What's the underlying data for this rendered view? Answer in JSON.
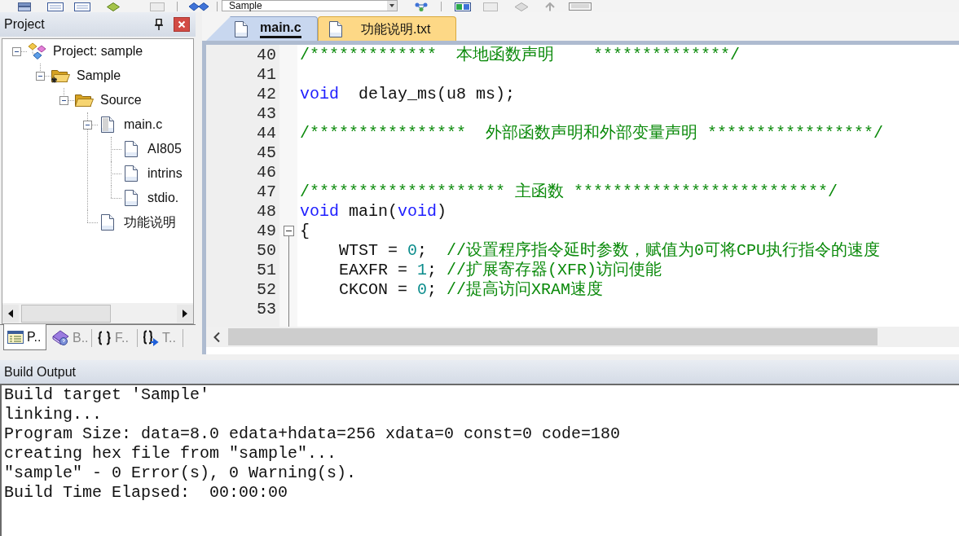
{
  "toolbar": {
    "target": "Sample"
  },
  "project_panel": {
    "title": "Project",
    "tree": [
      {
        "label": "Project: sample",
        "kind": "project",
        "expanded": true,
        "children": [
          {
            "label": "Sample",
            "kind": "target",
            "expanded": true,
            "children": [
              {
                "label": "Source",
                "kind": "folder",
                "expanded": true,
                "children": [
                  {
                    "label": "main.c",
                    "kind": "source",
                    "expanded": true,
                    "children": [
                      {
                        "label": "AI805",
                        "kind": "header"
                      },
                      {
                        "label": "intrins",
                        "kind": "header"
                      },
                      {
                        "label": "stdio.",
                        "kind": "header"
                      }
                    ]
                  },
                  {
                    "label": "功能说明",
                    "kind": "text"
                  }
                ]
              }
            ]
          }
        ]
      }
    ],
    "tabs": [
      {
        "label": "P..",
        "kind": "project",
        "selected": true
      },
      {
        "label": "B..",
        "kind": "books",
        "selected": false
      },
      {
        "label": "F..",
        "kind": "functions",
        "selected": false
      },
      {
        "label": "T..",
        "kind": "templates",
        "selected": false
      }
    ]
  },
  "editor": {
    "tabs": [
      {
        "label": "main.c",
        "selected": true
      },
      {
        "label": "功能说明.txt",
        "selected": false
      }
    ],
    "lines": [
      {
        "number": "40",
        "tokens": [
          {
            "kind": "comment",
            "text": "/*************  本地函数声明    **************/"
          }
        ]
      },
      {
        "number": "41"
      },
      {
        "number": "42",
        "tokens": [
          {
            "kind": "keyword",
            "text": "void"
          },
          {
            "kind": "plain",
            "text": "  delay_ms(u8 ms);"
          }
        ]
      },
      {
        "number": "43"
      },
      {
        "number": "44",
        "tokens": [
          {
            "kind": "comment",
            "text": "/****************  外部函数声明和外部变量声明 *****************/"
          }
        ]
      },
      {
        "number": "45"
      },
      {
        "number": "46"
      },
      {
        "number": "47",
        "tokens": [
          {
            "kind": "comment",
            "text": "/******************** 主函数 **************************/"
          }
        ]
      },
      {
        "number": "48",
        "tokens": [
          {
            "kind": "keyword",
            "text": "void"
          },
          {
            "kind": "plain",
            "text": " main("
          },
          {
            "kind": "keyword",
            "text": "void"
          },
          {
            "kind": "plain",
            "text": ")"
          }
        ]
      },
      {
        "number": "49",
        "fold": {
          "expanded": true
        },
        "tokens": [
          {
            "kind": "plain",
            "text": "{"
          }
        ]
      },
      {
        "number": "50",
        "tokens": [
          {
            "kind": "plain",
            "text": "    WTST = "
          },
          {
            "kind": "number",
            "text": "0"
          },
          {
            "kind": "plain",
            "text": ";  "
          },
          {
            "kind": "comment",
            "text": "//设置程序指令延时参数，赋值为0可将CPU执行指令的速度"
          }
        ]
      },
      {
        "number": "51",
        "tokens": [
          {
            "kind": "plain",
            "text": "    EAXFR = "
          },
          {
            "kind": "number",
            "text": "1"
          },
          {
            "kind": "plain",
            "text": "; "
          },
          {
            "kind": "comment",
            "text": "//扩展寄存器(XFR)访问使能"
          }
        ]
      },
      {
        "number": "52",
        "tokens": [
          {
            "kind": "plain",
            "text": "    CKCON = "
          },
          {
            "kind": "number",
            "text": "0"
          },
          {
            "kind": "plain",
            "text": "; "
          },
          {
            "kind": "comment",
            "text": "//提高访问XRAM速度"
          }
        ]
      },
      {
        "number": "53"
      }
    ]
  },
  "build_output": {
    "title": "Build Output",
    "lines": [
      "Build target 'Sample'",
      "linking...",
      "Program Size: data=8.0 edata+hdata=256 xdata=0 const=0 code=180",
      "creating hex file from \"sample\"...",
      "\"sample\" - 0 Error(s), 0 Warning(s).",
      "Build Time Elapsed:  00:00:00"
    ]
  }
}
